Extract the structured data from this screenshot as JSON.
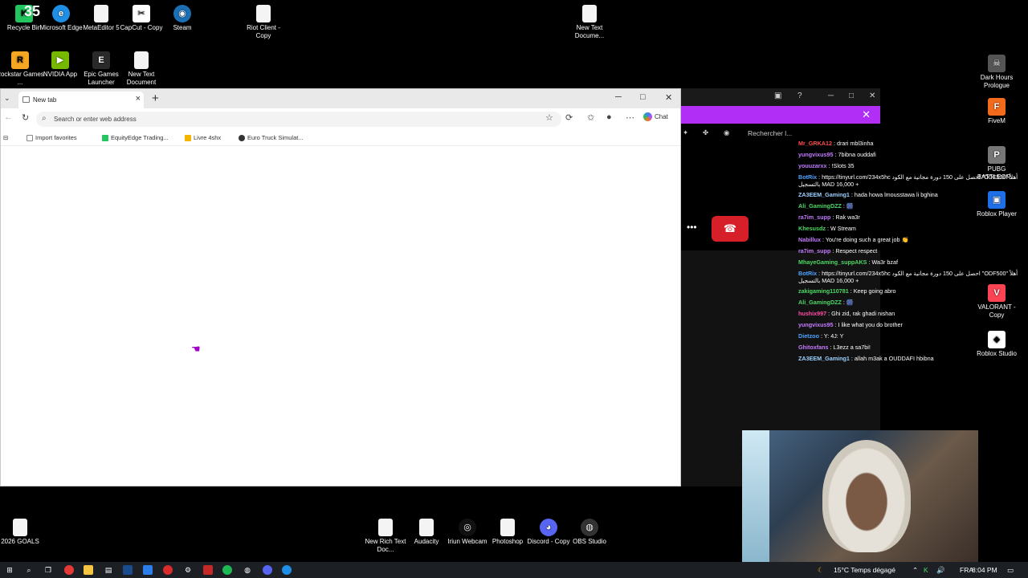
{
  "desktop_icons_top": [
    {
      "label": "Recycle Bin",
      "glyph": "K",
      "color": "#22c55e",
      "icon": "recycle-bin-icon"
    },
    {
      "label": "Microsoft Edge",
      "glyph": "e",
      "color": "#1f8fe5",
      "icon": "edge-icon"
    },
    {
      "label": "MetaEditor 5",
      "glyph": "",
      "color": "#f4f4f4",
      "icon": "document-icon"
    },
    {
      "label": "CapCut - Copy",
      "glyph": "✂",
      "color": "#ffffff",
      "icon": "capcut-icon"
    },
    {
      "label": "Steam",
      "glyph": "◉",
      "color": "#1b6fb5",
      "icon": "steam-icon"
    },
    {
      "label": "Riot Client - Copy",
      "glyph": "",
      "color": "#f4f4f4",
      "icon": "document-icon"
    },
    {
      "label": "New Text Docume...",
      "glyph": "",
      "color": "#f4f4f4",
      "icon": "document-icon"
    },
    {
      "label": "Rockstar Games ...",
      "glyph": "R",
      "color": "#f5a623",
      "icon": "rockstar-icon"
    },
    {
      "label": "NVIDIA App",
      "glyph": "▶",
      "color": "#76b900",
      "icon": "nvidia-icon"
    },
    {
      "label": "Epic Games Launcher",
      "glyph": "E",
      "color": "#2a2a2a",
      "icon": "epic-games-icon"
    },
    {
      "label": "New Text Document",
      "glyph": "",
      "color": "#f4f4f4",
      "icon": "document-icon"
    }
  ],
  "desktop_icons_right": [
    {
      "label": "Dark Hours Prologue",
      "glyph": "☠",
      "color": "#555"
    },
    {
      "label": "FiveM",
      "glyph": "F",
      "color": "#f26b1d"
    },
    {
      "label": "PUBG BATTLEGR...",
      "glyph": "P",
      "color": "#777"
    },
    {
      "label": "Roblox Player",
      "glyph": "▣",
      "color": "#1e6fe8"
    },
    {
      "label": "VALORANT - Copy",
      "glyph": "V",
      "color": "#fa4454"
    },
    {
      "label": "Roblox Studio",
      "glyph": "◆",
      "color": "#ffffff"
    }
  ],
  "top_counter": "35",
  "browser": {
    "tab_title": "New tab",
    "address_placeholder": "Search or enter web address",
    "chat_label": "Chat",
    "favorites": [
      {
        "label": "Import favorites",
        "color": "#888"
      },
      {
        "label": "EquityEdge Trading...",
        "color": "#22c55e"
      },
      {
        "label": "Livre 4shx",
        "color": "#f5b400"
      },
      {
        "label": "Euro Truck Simulat...",
        "color": "#333"
      }
    ]
  },
  "overlay": {
    "search_label": "Rechercher l...",
    "banner_color": "#b02ef5"
  },
  "chat_messages": [
    {
      "user": "Mr_GRKA12",
      "color": "#ff4d4d",
      "text": "drari mbl3inha"
    },
    {
      "user": "yungvixus95",
      "color": "#c47bff",
      "text": "7bibna ouddafi"
    },
    {
      "user": "youuzarxx",
      "color": "#c47bff",
      "text": "!Slots 35"
    },
    {
      "user": "BotRix",
      "color": "#4da3ff",
      "text": "https://tinyurl.com/234x5hc احصل على 150 دورة مجانية مع الكود \"ODF500\" أهلاً بالتسجيل MAD 16,000 +"
    },
    {
      "user": "ZA3EEM_Gaming1",
      "color": "#9ad0ff",
      "text": "hada howa lmousstawa li bghina"
    },
    {
      "user": "Ali_GamingDZZ",
      "color": "#4cd964",
      "text": "🎆"
    },
    {
      "user": "ra7im_supp",
      "color": "#c47bff",
      "text": "Rak wa3r"
    },
    {
      "user": "Khesusdz",
      "color": "#4cd964",
      "text": "W Stream"
    },
    {
      "user": "Nabillux",
      "color": "#c47bff",
      "text": "You're doing such a great job 👏"
    },
    {
      "user": "ra7im_supp",
      "color": "#c47bff",
      "text": "Respect respect"
    },
    {
      "user": "MhayeGaming_suppAKS",
      "color": "#4cd964",
      "text": "Wa3r bzaf"
    },
    {
      "user": "BotRix",
      "color": "#4da3ff",
      "text": "https://tinyurl.com/234x5hc احصل على 150 دورة مجانية مع الكود \"ODF500\" أهلاً بالتسجيل MAD 16,000 +"
    },
    {
      "user": "zakigaming110781",
      "color": "#4cd964",
      "text": "Keep going abro"
    },
    {
      "user": "Ali_GamingDZZ",
      "color": "#4cd964",
      "text": "🎆"
    },
    {
      "user": "hushix997",
      "color": "#ff4da6",
      "text": "Ghi zid, rak ghadi nishan"
    },
    {
      "user": "yungvixus95",
      "color": "#c47bff",
      "text": "I like what you do brother"
    },
    {
      "user": "Dietzoo",
      "color": "#4da3ff",
      "text": "Y: 4J: Y"
    },
    {
      "user": "Ghitoxfans",
      "color": "#c47bff",
      "text": "L3ezz a sa7bi!"
    },
    {
      "user": "ZA3EEM_Gaming1",
      "color": "#9ad0ff",
      "text": "allah m3ak a OUDDAFI hbibna"
    }
  ],
  "desktop_icons_bottom": [
    {
      "label": "2026 GOALS",
      "glyph": ""
    },
    {
      "label": "New Rich Text Doc...",
      "glyph": ""
    },
    {
      "label": "Audacity",
      "glyph": ""
    },
    {
      "label": "Iriun Webcam",
      "glyph": "◎"
    },
    {
      "label": "Photoshop",
      "glyph": ""
    },
    {
      "label": "Discord - Copy",
      "glyph": "◕"
    },
    {
      "label": "OBS Studio",
      "glyph": "◍"
    }
  ],
  "taskbar": {
    "weather": "15°C  Temps dégagé",
    "language": "FRA",
    "time": "8:04 PM"
  }
}
